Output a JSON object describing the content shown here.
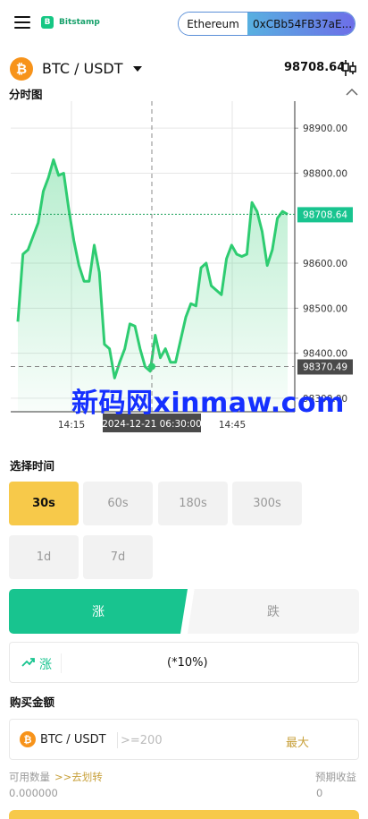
{
  "header": {
    "brand": "Bitstamp",
    "network": "Ethereum",
    "address": "0xCBb54FB37aE..."
  },
  "pair": {
    "coin_symbol": "₿",
    "name": "BTC / USDT",
    "price": "98708.64"
  },
  "chart_section": {
    "title": "分时图"
  },
  "chart_data": {
    "type": "area",
    "y_ticks": [
      "98900.00",
      "98800.00",
      "98708.64",
      "98600.00",
      "98500.00",
      "98400.00",
      "98370.49",
      "98300.00"
    ],
    "x_ticks": [
      "14:15",
      "2024-12-21 06:30:00",
      "14:45"
    ],
    "ylim": [
      98270,
      98960
    ],
    "current_price_label": "98708.64",
    "crosshair_price_label": "98370.49",
    "crosshair_time_label": "2024-12-21 06:30:00",
    "line_color": "#2ecc71",
    "series": [
      {
        "values": [
          98470,
          98620,
          98630,
          98660,
          98690,
          98760,
          98790,
          98830,
          98795,
          98800,
          98720,
          98650,
          98595,
          98560,
          98560,
          98640,
          98580,
          98420,
          98410,
          98345,
          98380,
          98410,
          98465,
          98460,
          98410,
          98370,
          98360,
          98440,
          98390,
          98410,
          98380,
          98380,
          98430,
          98480,
          98510,
          98505,
          98590,
          98600,
          98550,
          98540,
          98530,
          98610,
          98640,
          98620,
          98615,
          98620,
          98735,
          98715,
          98670,
          98595,
          98630,
          98700,
          98715,
          98708.64
        ]
      }
    ],
    "grid": true
  },
  "time_section": {
    "title": "选择时间",
    "options": [
      "30s",
      "60s",
      "180s",
      "300s",
      "1d",
      "7d"
    ],
    "selected": "30s"
  },
  "direction": {
    "up_label": "涨",
    "down_label": "跌"
  },
  "rate": {
    "direction_label": "涨",
    "value": "(*10%)"
  },
  "amount_section": {
    "title": "购买金额",
    "pair": "BTC / USDT",
    "placeholder": ">=200",
    "max_label": "最大"
  },
  "balance": {
    "available_label": "可用数量",
    "transfer_link": ">>去划转",
    "available_value": "0.000000",
    "expected_label": "预期收益",
    "expected_value": "0"
  },
  "watermark": "新码网xinmaw.com",
  "colors": {
    "accent_yellow": "#f7c94a",
    "accent_green": "#18c48f",
    "btc_orange": "#f7931a"
  }
}
